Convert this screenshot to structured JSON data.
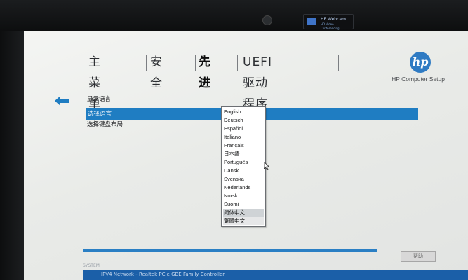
{
  "camera_badge": {
    "title": "HP Webcam",
    "subtitle": "HD Video Conferencing"
  },
  "menu": {
    "items": [
      {
        "label": "主菜单"
      },
      {
        "label": "安全"
      },
      {
        "label": "先进",
        "active": true
      },
      {
        "label": "UEFI 驱动程序"
      }
    ]
  },
  "brand": {
    "logo_text": "hp",
    "product": "HP Computer Setup",
    "accent_color": "#1f7dc2"
  },
  "settings": {
    "display_language_label": "显示语言",
    "select_language_label": "选择语言",
    "keyboard_layout_label": "选择键盘布局"
  },
  "language_dropdown": {
    "options": [
      "English",
      "Deutsch",
      "Español",
      "Italiano",
      "Français",
      "日本語",
      "Português",
      "Dansk",
      "Svenska",
      "Nederlands",
      "Norsk",
      "Suomi",
      "简体中文",
      "繁體中文"
    ],
    "highlighted": "简体中文",
    "selected": "繁體中文"
  },
  "bottom": {
    "apply_button": "帮助",
    "status_text": "IPV4 Network - Realtek PCIe GBE Family Controller",
    "faint_text": "SYSTEM"
  },
  "icons": {
    "back": "back-arrow-icon",
    "cursor": "mouse-cursor-icon"
  }
}
